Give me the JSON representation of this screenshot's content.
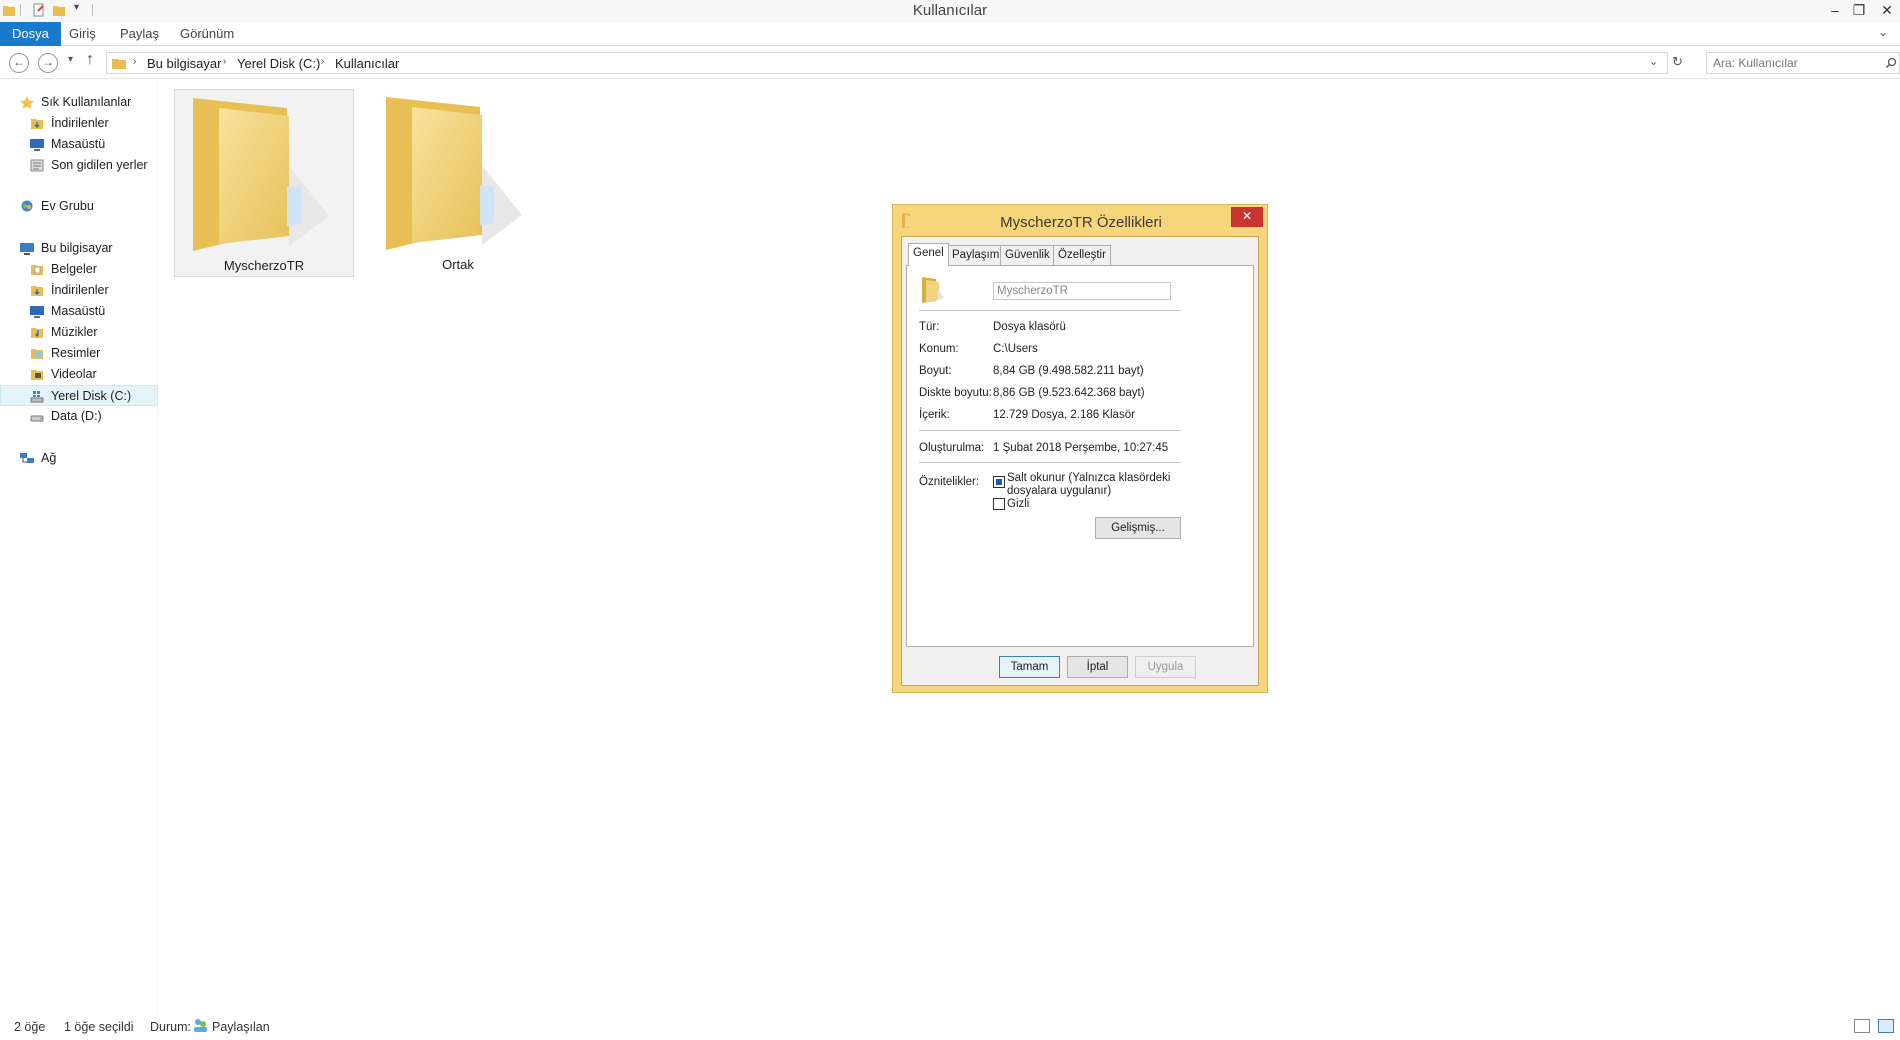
{
  "window": {
    "title": "Kullanıcılar"
  },
  "ribbon": {
    "tabs": [
      "Dosya",
      "Giriş",
      "Paylaş",
      "Görünüm"
    ]
  },
  "address": {
    "crumbs": [
      "Bu bilgisayar",
      "Yerel Disk (C:)",
      "Kullanıcılar"
    ],
    "search_placeholder": "Ara: Kullanıcılar"
  },
  "nav": {
    "favorites": {
      "label": "Sık Kullanılanlar",
      "items": [
        "İndirilenler",
        "Masaüstü",
        "Son gidilen yerler"
      ]
    },
    "homegroup": {
      "label": "Ev Grubu"
    },
    "computer": {
      "label": "Bu bilgisayar",
      "items": [
        "Belgeler",
        "İndirilenler",
        "Masaüstü",
        "Müzikler",
        "Resimler",
        "Videolar",
        "Yerel Disk (C:)",
        "Data (D:)"
      ]
    },
    "network": {
      "label": "Ağ"
    }
  },
  "content": {
    "folders": [
      "MyscherzoTR",
      "Ortak"
    ]
  },
  "status": {
    "count": "2 öğe",
    "selected": "1 öğe seçildi",
    "state_label": "Durum:",
    "state_value": "Paylaşılan"
  },
  "dialog": {
    "title": "MyscherzoTR Özellikleri",
    "close_glyph": "✕",
    "tabs": [
      "Genel",
      "Paylaşım",
      "Güvenlik",
      "Özelleştir"
    ],
    "name_value": "MyscherzoTR",
    "rows": [
      {
        "label": "Tür:",
        "value": "Dosya klasörü"
      },
      {
        "label": "Konum:",
        "value": "C:\\Users"
      },
      {
        "label": "Boyut:",
        "value": "8,84 GB (9.498.582.211 bayt)"
      },
      {
        "label": "Diskte boyutu:",
        "value": "8,86 GB (9.523.642.368 bayt)"
      },
      {
        "label": "İçerik:",
        "value": "12.729 Dosya, 2.186 Klasör"
      }
    ],
    "created": {
      "label": "Oluşturulma:",
      "value": "1 Şubat 2018 Perşembe, 10:27:45"
    },
    "attributes": {
      "label": "Öznitelikler:",
      "readonly": "Salt okunur (Yalnızca klasördeki dosyalara uygulanır)",
      "hidden": "Gizli"
    },
    "advanced": "Gelişmiş...",
    "buttons": {
      "ok": "Tamam",
      "cancel": "İptal",
      "apply": "Uygula"
    }
  },
  "colors": {
    "accent": "#1979ca",
    "folder": "#f4d27a",
    "dialog_frame": "#f7d57b",
    "close": "#c7372f"
  }
}
